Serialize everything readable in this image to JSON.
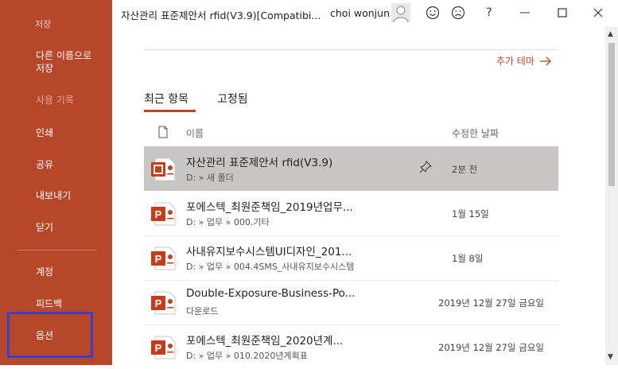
{
  "sidebar": {
    "top_partial": "저장",
    "items": [
      {
        "label_line1": "다른 이름으로",
        "label_line2": "저장"
      },
      {
        "label": "사용 기록"
      },
      {
        "label": "인쇄"
      },
      {
        "label": "공유"
      },
      {
        "label": "내보내기"
      },
      {
        "label": "닫기"
      },
      {
        "label": "계정"
      },
      {
        "label": "피드백"
      },
      {
        "label": "옵션"
      }
    ]
  },
  "titlebar": {
    "document_title": "자산관리 표준제안서 rfid(V3.9)[Compatibi...",
    "user_name": "choi wonjun",
    "smile_icon": "smile-icon",
    "frown_icon": "frown-icon",
    "help_label": "?"
  },
  "main": {
    "more_themes": "추가 테마",
    "tabs": [
      {
        "label": "최근 항목"
      },
      {
        "label": "고정됨"
      }
    ],
    "headers": {
      "name": "이름",
      "modified": "수정한 날짜"
    },
    "files": [
      {
        "name": "자산관리 표준제안서 rfid(V3.9)",
        "path": "D: » 새 폴더",
        "date": "2분 전",
        "selected": true
      },
      {
        "name": "포에스텍_최원준책임_2019년업무...",
        "path": "D: » 업무 » 000.기타",
        "date": "1월 15일"
      },
      {
        "name": "사내유지보수시스템UI디자인_201...",
        "path": "D: » 업무 » 004.4SMS_사내유지보수시스템",
        "date": "1월 8일"
      },
      {
        "name": "Double-Exposure-Business-Po...",
        "path": "다운로드",
        "date": "2019년 12월 27일 금요일"
      },
      {
        "name": "포에스텍_최원준책임_2020년계...",
        "path": "D: » 업무 » 010.2020년계획표",
        "date": "2019년 12월 27일 금요일"
      }
    ]
  },
  "colors": {
    "accent": "#b7472a",
    "highlight_box": "#3c3fcb",
    "selected_row": "#c8c6c4"
  }
}
